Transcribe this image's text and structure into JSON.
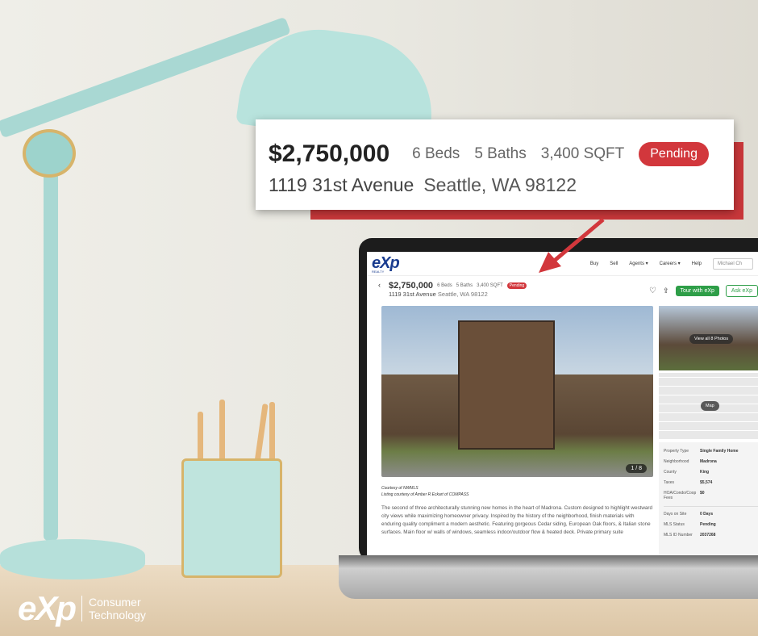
{
  "callout": {
    "price": "$2,750,000",
    "beds": "6 Beds",
    "baths": "5 Baths",
    "sqft": "3,400 SQFT",
    "status": "Pending",
    "street": "1119 31st Avenue",
    "city": "Seattle, WA 98122"
  },
  "nav": {
    "logo": "eXp",
    "logo_sub": "REALTY",
    "links": [
      "Buy",
      "Sell",
      "Agents ▾",
      "Careers ▾",
      "Help"
    ],
    "search_placeholder": "Michael Ch"
  },
  "listing": {
    "price": "$2,750,000",
    "beds": "6 Beds",
    "baths": "5 Baths",
    "sqft": "3,400 SQFT",
    "status": "Pending",
    "street": "1119 31st Avenue",
    "city": "Seattle, WA 98122",
    "tour_label": "Tour with eXp",
    "ask_label": "Ask eXp",
    "photo_counter": "1 / 8",
    "view_all": "View all 8 Photos",
    "map_label": "Map",
    "courtesy": "Courtesy of NWMLS",
    "listing_courtesy": "Listing courtesy of Amber R Eckart of COMPASS",
    "description": "The second of three architecturally stunning new homes in the heart of Madrona. Custom designed to highlight westward city views while maximizing homeowner privacy. Inspired by the history of the neighborhood, finish materials with enduring quality compliment a modern aesthetic. Featuring gorgeous Cedar siding, European Oak floors, & Italian stone surfaces. Main floor w/ walls of windows, seamless indoor/outdoor flow & heated deck. Private primary suite",
    "facts": [
      [
        "Property Type",
        "Single Family Home"
      ],
      [
        "Neighborhood",
        "Madrona"
      ],
      [
        "County",
        "King"
      ],
      [
        "Taxes",
        "$5,574"
      ],
      [
        "HOA/Condo/Coop Fees",
        "$0"
      ]
    ],
    "facts2": [
      [
        "Days on Site",
        "0 Days"
      ],
      [
        "MLS Status",
        "Pending"
      ],
      [
        "MLS ID Number",
        "2037268"
      ]
    ]
  },
  "brand": {
    "mark": "eXp",
    "line1": "Consumer",
    "line2": "Technology"
  },
  "colors": {
    "accent_red": "#d2373c",
    "green": "#2e9e48",
    "brand_blue": "#1a3c8f"
  }
}
